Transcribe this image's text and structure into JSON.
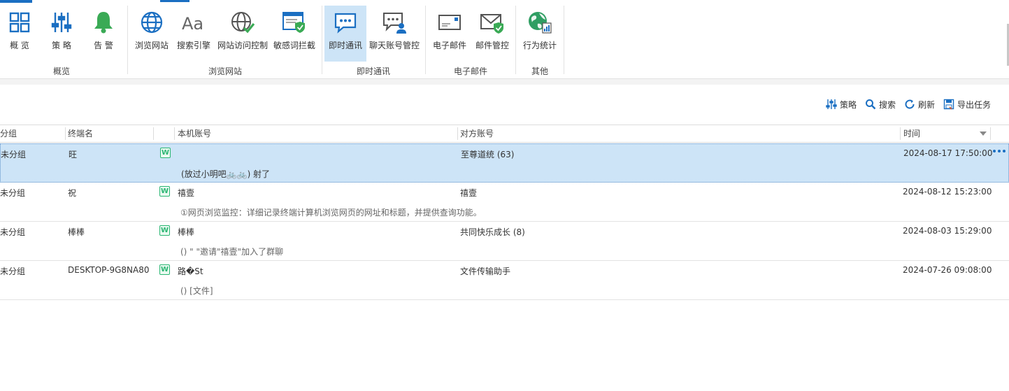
{
  "ribbon": {
    "buttons": [
      {
        "label": "概 览",
        "icon": "grid-dashboard-icon"
      },
      {
        "label": "策 略",
        "icon": "sliders-icon"
      },
      {
        "label": "告 警",
        "icon": "bell-icon"
      },
      {
        "label": "浏览网站",
        "icon": "globe-icon"
      },
      {
        "label": "搜索引擎",
        "icon": "font-aa-icon"
      },
      {
        "label": "网站访问控制",
        "icon": "globe-check-icon"
      },
      {
        "label": "敏感词拦截",
        "icon": "browser-shield-icon"
      },
      {
        "label": "即时通讯",
        "icon": "chat-bubble-icon"
      },
      {
        "label": "聊天账号管控",
        "icon": "chat-user-icon"
      },
      {
        "label": "电子邮件",
        "icon": "envelope-icon"
      },
      {
        "label": "邮件管控",
        "icon": "envelope-shield-icon"
      },
      {
        "label": "行为统计",
        "icon": "earth-chart-icon"
      }
    ],
    "groups": [
      "概览",
      "浏览网站",
      "即时通讯",
      "电子邮件",
      "其他"
    ]
  },
  "toolbar": {
    "policy": "策略",
    "search": "搜索",
    "refresh": "刷新",
    "export": "导出任务"
  },
  "colors": {
    "accent": "#1b6fc2",
    "selected_row": "#cde4f7",
    "wechat_green": "#2bb673"
  },
  "table": {
    "headers": [
      "分组",
      "终端名",
      "本机账号",
      "对方账号",
      "时间"
    ],
    "rows": [
      {
        "group": "未分组",
        "terminal": "旺",
        "local_account": "",
        "peer_account": "至尊道统 (63)",
        "time": "2024-08-17 17:50:00",
        "message": "(放过小明吧🚲🚲) 射了"
      },
      {
        "group": "未分组",
        "terminal": "祝",
        "local_account": "禧壹",
        "peer_account": "禧壹",
        "time": "2024-08-12 15:23:00",
        "message": "①网页浏览监控：详细记录终端计算机浏览网页的网址和标题，并提供查询功能。"
      },
      {
        "group": "未分组",
        "terminal": "棒棒",
        "local_account": "棒棒",
        "peer_account": "共同快乐成长 (8)",
        "time": "2024-08-03 15:29:00",
        "message": "() \"      \"邀请\"禧壹\"加入了群聊"
      },
      {
        "group": "未分组",
        "terminal": "DESKTOP-9G8NA80",
        "local_account": "路�St",
        "peer_account": "文件传输助手",
        "time": "2024-07-26 09:08:00",
        "message": "() [文件]"
      }
    ],
    "app_badge": "W"
  }
}
